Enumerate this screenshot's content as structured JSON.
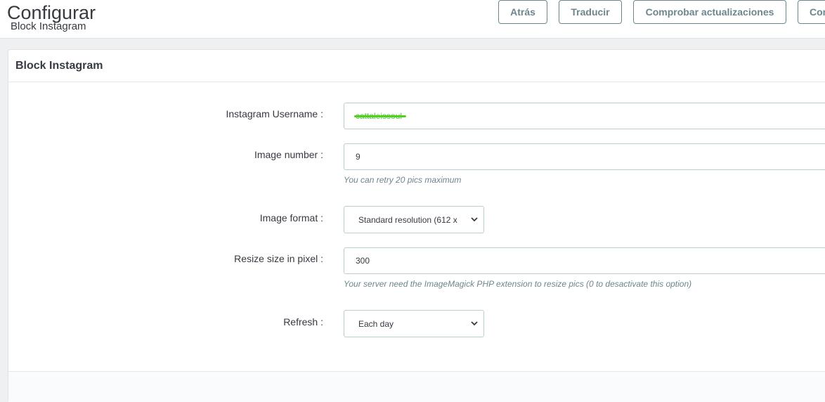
{
  "header": {
    "title": "Configurar",
    "subtitle": "Block Instagram",
    "buttons": {
      "back": "Atrás",
      "translate": "Traducir",
      "check_updates": "Comprobar actualizaciones",
      "more": "Con"
    }
  },
  "panel": {
    "title": "Block Instagram",
    "fields": {
      "username": {
        "label": "Instagram Username :",
        "value": "cattaleissoul"
      },
      "image_number": {
        "label": "Image number :",
        "value": "9",
        "help": "You can retry 20 pics maximum"
      },
      "image_format": {
        "label": "Image format :",
        "value": "Standard resolution (612 x"
      },
      "resize": {
        "label": "Resize size in pixel :",
        "value": "300",
        "help": "Your server need the ImageMagick PHP extension to resize pics (0 to desactivate this option)"
      },
      "refresh": {
        "label": "Refresh :",
        "value": "Each day"
      }
    }
  },
  "colors": {
    "accent": "#6c868e",
    "border": "#bbcdd2",
    "redaction": "#4fd11f"
  }
}
